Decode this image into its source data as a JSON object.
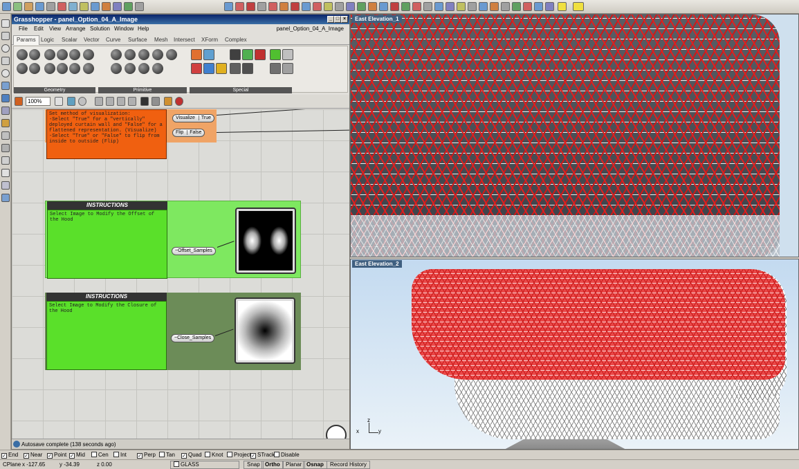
{
  "grasshopper": {
    "title": "Grasshopper - panel_Option_04_A_Image",
    "window_min": "_",
    "window_max": "□",
    "window_close": "×",
    "menu": [
      "File",
      "Edit",
      "View",
      "Arrange",
      "Solution",
      "Window",
      "Help"
    ],
    "file_label": "panel_Option_04_A_Image",
    "tabs": [
      "Params",
      "Logic",
      "Scalar",
      "Vector",
      "Curve",
      "Surface",
      "Mesh",
      "Intersect",
      "XForm",
      "Complex"
    ],
    "active_tab": "Params",
    "groups": [
      "Geometry",
      "Primitive",
      "Special"
    ],
    "zoom": "100%",
    "status": "Autosave complete (138 seconds ago)"
  },
  "canvas": {
    "orange_panel_text": "Set method of visualization:\n-Select \"True\" for a \"vertically\" deployed curtain wall and \"False\" for a flattened representation. (Visualize)\n-Select \"True\" or \"False\" to flip from inside to outside (Flip)",
    "visualize_label": "Visualize",
    "visualize_value": "True",
    "flip_label": "Flip",
    "flip_value": "False",
    "instructions_title": "INSTRUCTIONS",
    "instructions_1": "Select Image to Modify the Offset of the Hood",
    "instructions_2": "Select Image to Modify the Closure of the Hood",
    "offset_samples": "~Offset_Samples",
    "close_samples": "~Close_Samples"
  },
  "viewports": {
    "top_title": "East Elevation_1",
    "bottom_title": "East Elevation_2",
    "axis_z": "z",
    "axis_x": "x",
    "axis_y": "y"
  },
  "osnap": {
    "items": [
      {
        "label": "End",
        "checked": true
      },
      {
        "label": "Near",
        "checked": true
      },
      {
        "label": "Point",
        "checked": true
      },
      {
        "label": "Mid",
        "checked": true
      },
      {
        "label": "Cen",
        "checked": false
      },
      {
        "label": "Int",
        "checked": false
      },
      {
        "label": "Perp",
        "checked": true
      },
      {
        "label": "Tan",
        "checked": false
      },
      {
        "label": "Quad",
        "checked": true
      },
      {
        "label": "Knot",
        "checked": false
      },
      {
        "label": "Project",
        "checked": false
      },
      {
        "label": "STrack",
        "checked": true
      },
      {
        "label": "Disable",
        "checked": false
      }
    ]
  },
  "statusbar": {
    "cplane": "CPlane",
    "x": "x -127.65",
    "y": "y -34.39",
    "z": "z 0.00",
    "layer": "GLASS",
    "snap": "Snap",
    "ortho": "Ortho",
    "planar": "Planar",
    "osnap": "Osnap",
    "record_history": "Record History"
  },
  "colors": {
    "orange_panel": "#f06010",
    "green_panel": "#5ae02a",
    "mesh_red": "#e02020",
    "title_blue": "#0a246a"
  }
}
